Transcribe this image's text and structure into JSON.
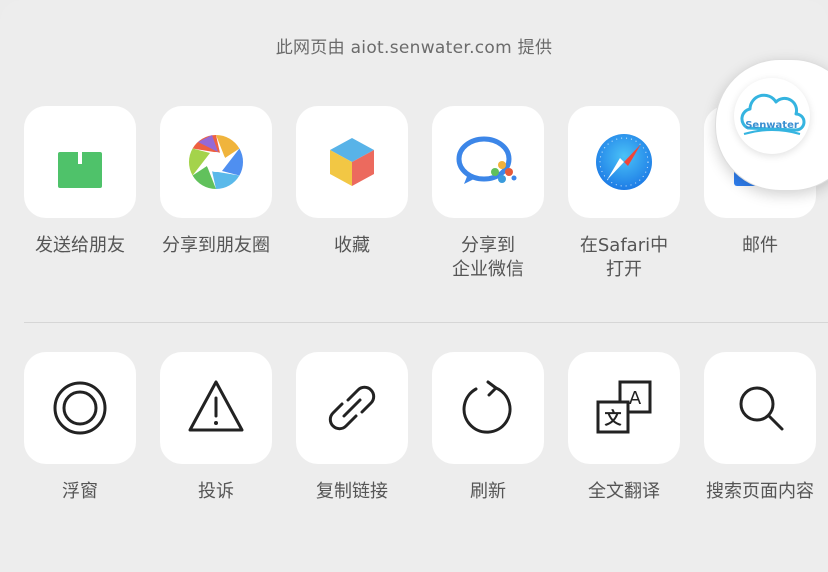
{
  "header": {
    "provider_text": "此网页由 aiot.senwater.com 提供"
  },
  "share_row": [
    {
      "label": "发送给朋友",
      "icon": "send-to-friend-icon"
    },
    {
      "label": "分享到朋友圈",
      "icon": "moments-icon"
    },
    {
      "label": "收藏",
      "icon": "favorites-cube-icon"
    },
    {
      "label": "分享到",
      "label2": "企业微信",
      "icon": "wecom-icon"
    },
    {
      "label": "在Safari中",
      "label2": "打开",
      "icon": "safari-compass-icon"
    },
    {
      "label": "邮件",
      "icon": "mail-icon"
    }
  ],
  "action_row": [
    {
      "label": "浮窗",
      "icon": "float-window-icon"
    },
    {
      "label": "投诉",
      "icon": "warning-triangle-icon"
    },
    {
      "label": "复制链接",
      "icon": "link-icon"
    },
    {
      "label": "刷新",
      "icon": "refresh-icon"
    },
    {
      "label": "全文翻译",
      "icon": "translate-icon"
    },
    {
      "label": "搜索页面内容",
      "icon": "search-icon"
    }
  ],
  "float_bubble": {
    "logo_text": "Senwater",
    "icon": "senwater-cloud-logo"
  },
  "colors": {
    "wechat_green": "#4fc26a",
    "tile_bg": "#ffffff",
    "sheet_bg": "#ededed",
    "label_text": "#555555"
  }
}
